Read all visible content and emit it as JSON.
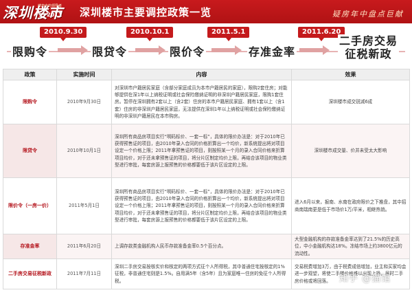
{
  "header": {
    "logo_text": "深圳楼市",
    "logo_sub": "楼市中的领导者",
    "logo_year": "2011",
    "title": "深圳楼市主要调控政策一览",
    "slogan": "疑房年中盘点巨献"
  },
  "timeline": {
    "steps": [
      {
        "label": "限购令"
      },
      {
        "label": "限贷令"
      },
      {
        "label": "限价令"
      },
      {
        "label": "存准金率"
      },
      {
        "label_line1": "二手房交易",
        "label_line2": "征税新政"
      }
    ],
    "dates": [
      "2010.9.30",
      "2010.10.1",
      "2011.5.1",
      "2011.6.20"
    ]
  },
  "table": {
    "headers": [
      "政策",
      "实施时间",
      "内容",
      "效果"
    ],
    "rows": [
      {
        "policy": "限购令",
        "time": "2010年9月30日",
        "content": "对深圳市户籍居民家庭（含部分家庭成员为本市户籍居民的家庭），限购2套住房；对能够提供在深1年以上纳税证明或社会保险缴纳证明的非深圳户籍居民家庭，限购1套住房。暂停在深圳拥有2套以上（含2套）住房的本市户籍居民家庭、拥有1套以上（含1套）住房的非深圳户籍居民家庭，无法提供在深圳1年以上纳税证明或社会保险缴纳证明的非深圳户籍居民在本市购房。",
        "effect": "深圳楼市成交锐减6成"
      },
      {
        "policy": "限贷令",
        "time": "2010年10月1日",
        "content": "深圳所有商品房项目实行“明码标价、一套一标”，具体的限价办法是：对于2010年已获得预售证的项目，由2010年录入合同的价格折算出一个均价，新系统提出将对项目设定一个价格上限；2011年拿预售证的项目，则按照某一个月的录入合同价格来折算项目均价，对于还未拿预售证的项目，将分片区制定均价上限，再结合该项目的物业类型进行审批，每套房源上报预售的价格都要低于该片区设定的上限。",
        "effect": "深圳楼市成交量、价并未受太大影响"
      },
      {
        "policy": "限价令（一房一价）",
        "time": "2011年5月1日",
        "content": "深圳所有商品房项目实行“明码标价、一套一标”，具体的限价办法是：对于2010年已获得预售证的项目，由2010年录入合同的价格折算出一个均价，新系统提出将对项目设定一个价格上限；2011年拿预售证的项目，则按照某一个月的录入合同价格来折算项目均价，对于还未拿预售证的项目，将分片区制定均价上限，再结合该项目的物业类型进行审批，每套房源上报预售的价格都要低于该片区设定的上限。",
        "effect": "进入6月以来，报南、水南在政府限价之下推盘，其中招商南瑞南更是低于市场价1万/平米，相继热销。"
      },
      {
        "policy": "存准金率",
        "time": "2011年6月20日",
        "content": "上调存款类金融机构人民币存款准备金率0.5个百分点。",
        "effect": "大型金融机构的存款准备金率达到了21.5%的历史高位，中小金融机构达18%。冻结市场上约3800亿元的流动性。"
      },
      {
        "policy": "二手房交易征税新政",
        "time": "2011年7月11日",
        "content": "深圳二手房交易按核实价和核定的两项方式征个人所得税，其中普通住宅按核定的1%征税，非普通住宅则是1.5%。自用满5年（含5年）且为家庭唯一住房的免征个人所得税。",
        "effect": "交易税费增加3万，由于税费成倍增加，业主和买家均会进一步观望，将使二手楼价格难以出现上扬，届时二手房价格或将回落。"
      }
    ]
  },
  "watermark": "知乎 @猫馆"
}
